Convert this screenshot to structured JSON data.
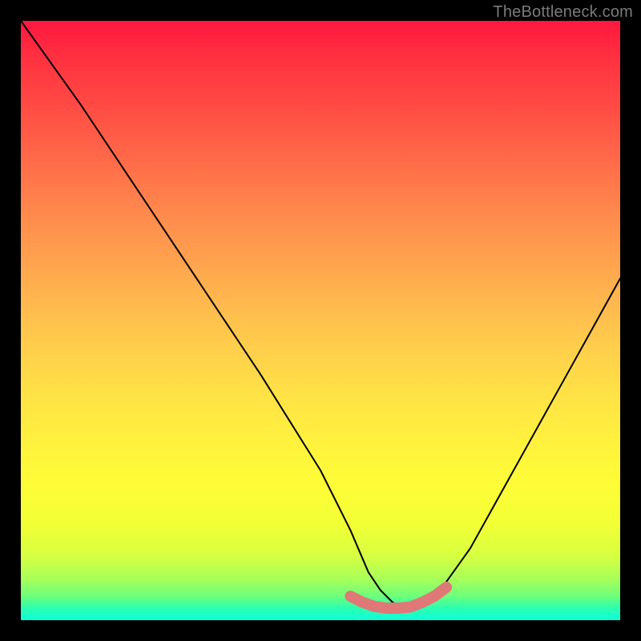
{
  "watermark": "TheBottleneck.com",
  "chart_data": {
    "type": "line",
    "title": "",
    "xlabel": "",
    "ylabel": "",
    "xlim": [
      0,
      100
    ],
    "ylim": [
      0,
      100
    ],
    "grid": false,
    "legend": false,
    "series": [
      {
        "name": "curve",
        "color": "#000000",
        "x": [
          0,
          10,
          20,
          30,
          40,
          45,
          50,
          55,
          58,
          60,
          62,
          64,
          66,
          68,
          70,
          75,
          80,
          85,
          90,
          95,
          100
        ],
        "values": [
          100,
          86,
          71,
          56,
          41,
          33,
          25,
          15,
          8,
          5,
          3,
          2,
          2,
          3,
          5,
          12,
          21,
          30,
          39,
          48,
          57
        ]
      },
      {
        "name": "highlight-band",
        "color": "#e57373",
        "x": [
          55,
          57,
          59,
          61,
          63,
          65,
          67,
          69,
          71
        ],
        "values": [
          4,
          3,
          2.3,
          2,
          2,
          2.2,
          3,
          4,
          5.5
        ]
      }
    ]
  }
}
